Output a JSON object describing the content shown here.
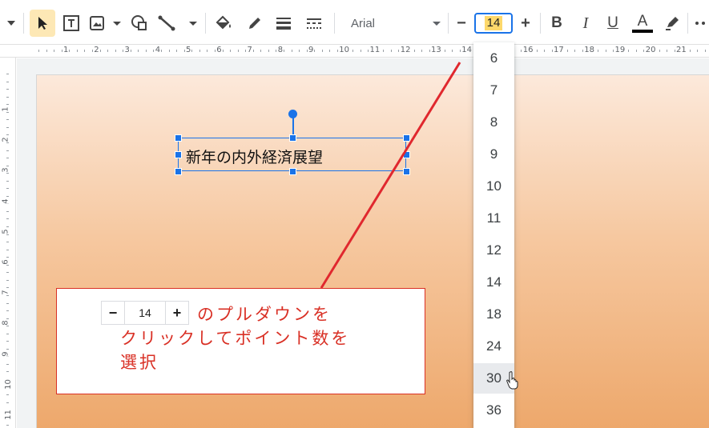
{
  "toolbar": {
    "font_name": "Arial",
    "font_size": "14",
    "icons": [
      "chevron-down-icon",
      "select-arrow-icon",
      "text-box-icon",
      "image-icon",
      "shape-icon",
      "line-icon",
      "fill-color-icon",
      "border-color-icon",
      "border-weight-icon",
      "border-dash-icon",
      "bold-icon",
      "italic-icon",
      "underline-icon",
      "text-color-icon",
      "highlight-icon",
      "more-icon"
    ],
    "bold_label": "B",
    "italic_label": "I",
    "underline_label": "U",
    "text_color_label": "A",
    "minus_label": "−",
    "plus_label": "+",
    "text_color": "#000000",
    "active_bg": "#fde8b5"
  },
  "ruler": {
    "horizontal": [
      "1",
      "2",
      "3",
      "4",
      "5",
      "6",
      "7",
      "8",
      "9",
      "10",
      "11",
      "12",
      "13",
      "14",
      "15",
      "16",
      "17",
      "18",
      "19",
      "20",
      "21"
    ],
    "vertical": [
      "1",
      "2",
      "3",
      "4",
      "5",
      "6",
      "7",
      "8",
      "9",
      "10",
      "11"
    ]
  },
  "slide": {
    "textbox_text": "新年の内外経済展望"
  },
  "callout": {
    "stepper": {
      "minus": "−",
      "value": "14",
      "plus": "+"
    },
    "line1": "のプルダウンを",
    "line2": "クリックしてポイント数を",
    "line3": "選択",
    "accent": "#d93025"
  },
  "size_dropdown": {
    "options": [
      "6",
      "7",
      "8",
      "9",
      "10",
      "11",
      "12",
      "14",
      "18",
      "24",
      "30",
      "36"
    ],
    "hovered": "30"
  }
}
